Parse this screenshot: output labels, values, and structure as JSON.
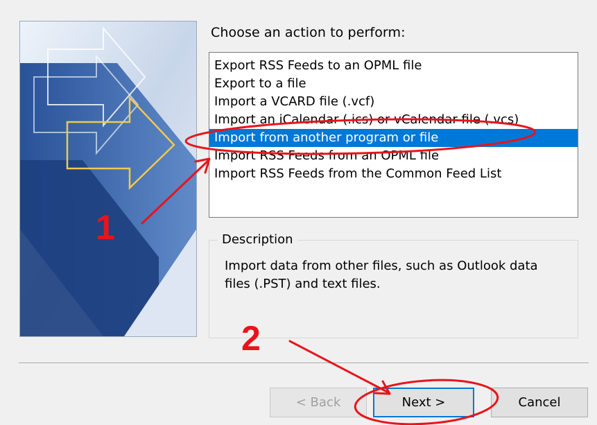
{
  "wizard": {
    "prompt": "Choose an action to perform:",
    "actions": [
      {
        "label": "Export RSS Feeds to an OPML file"
      },
      {
        "label": "Export to a file"
      },
      {
        "label": "Import a VCARD file (.vcf)"
      },
      {
        "label": "Import an iCalendar (.ics) or vCalendar file (.vcs)"
      },
      {
        "label": "Import from another program or file",
        "selected": true
      },
      {
        "label": "Import RSS Feeds from an OPML file"
      },
      {
        "label": "Import RSS Feeds from the Common Feed List"
      }
    ],
    "description": {
      "legend": "Description",
      "text": "Import data from other files, such as Outlook data files (.PST) and text files."
    },
    "buttons": {
      "back": "< Back",
      "next": "Next >",
      "cancel": "Cancel"
    }
  },
  "annotations": {
    "step1": "1",
    "step2": "2",
    "color": "#e8141b"
  },
  "colors": {
    "selection": "#0078d7",
    "art_blue": "#2f5fa8",
    "arrow_yellow": "#f2c94c"
  }
}
